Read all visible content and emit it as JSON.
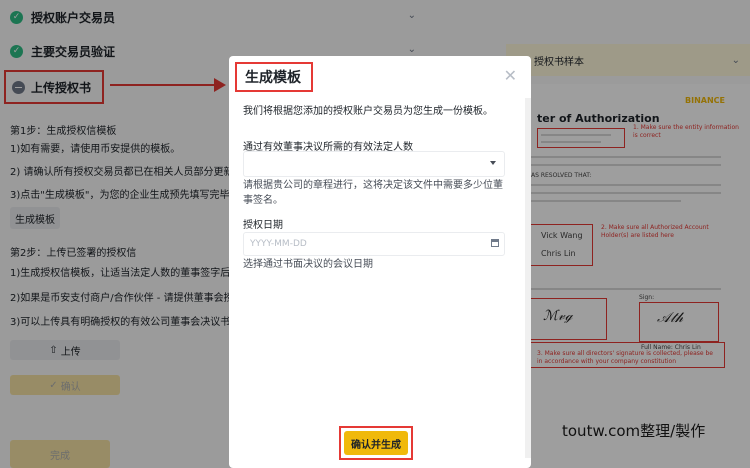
{
  "steps": {
    "authorize_accounts": "授权账户交易员",
    "verify_main_trader": "主要交易员验证",
    "upload_letter": "上传授权书"
  },
  "instructions": {
    "step1_title": "第1步：生成授权信模板",
    "step1_line1": "1)如有需要，请使用币安提供的模板。",
    "step1_line2": "2) 请确认所有授权交易员都已在相关人员部分更新",
    "step1_line3": "3)点击\"生成模板\"，为您的企业生成预先填写完毕的授权",
    "generate_button": "生成模板",
    "step2_title": "第2步：上传已签署的授权信",
    "step2_line1": "1)生成授权信模板，让适当法定人数的董事签字后在此上",
    "step2_line2": "2)如果是币安支付商户/合作伙伴 - 请提供董事会授权代表",
    "step2_line3": "3)可以上传具有明确授权的有效公司董事会决议书，代替",
    "upload_button": "上传",
    "confirm_button": "确认",
    "done_button": "完成"
  },
  "sample": {
    "header": "授权书样本",
    "title": "ter of Authorization",
    "brand": "BINANCE",
    "note1": "1. Make sure the entity information is correct",
    "note2": "2. Make sure all Authorized Account Holder(s) are listed here",
    "note3": "3. Make sure all directors' signature is collected, please be in accordance with your company constitution",
    "name1": "Vick Wang",
    "name2": "Chris Lin",
    "sign_label": "Sign:",
    "full_name_label": "Full Name: Chris Lin",
    "resolved": "AS RESOLVED THAT:"
  },
  "modal": {
    "title": "生成模板",
    "description": "我们将根据您添加的授权账户交易员为您生成一份模板。",
    "directors_label": "通过有效董事决议所需的有效法定人数",
    "directors_help": "请根据贵公司的章程进行，这将决定该文件中需要多少位董事签名。",
    "date_label": "授权日期",
    "date_placeholder": "YYYY-MM-DD",
    "date_help": "选择通过书面决议的会议日期",
    "confirm_generate": "确认并生成"
  },
  "watermark": "toutw.com整理/製作"
}
